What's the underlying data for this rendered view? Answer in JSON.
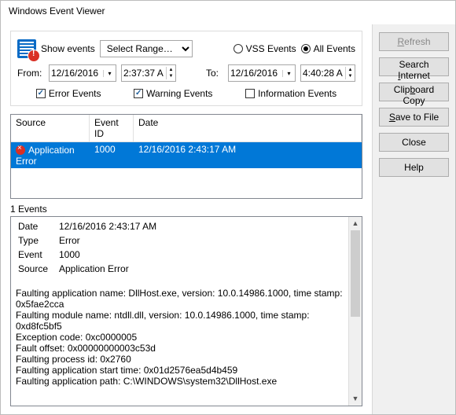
{
  "title": "Windows Event Viewer",
  "buttons": {
    "refresh": "Refresh",
    "search": "Search Internet",
    "clipboard": "Clipboard Copy",
    "save": "Save to File",
    "close": "Close",
    "help": "Help"
  },
  "filter": {
    "show_events_label": "Show events",
    "range_select": "Select Range…",
    "vss_label": "VSS Events",
    "all_label": "All Events",
    "from_label": "From:",
    "to_label": "To:",
    "from_date": "12/16/2016",
    "from_time": "2:37:37 A",
    "to_date": "12/16/2016",
    "to_time": "4:40:28 A",
    "error_label": "Error Events",
    "warning_label": "Warning Events",
    "info_label": "Information Events"
  },
  "columns": {
    "source": "Source",
    "event_id": "Event ID",
    "date": "Date"
  },
  "rows": [
    {
      "source": "Application Error",
      "event_id": "1000",
      "date": "12/16/2016 2:43:17 AM"
    }
  ],
  "count_label": "1 Events",
  "details": {
    "labels": {
      "date": "Date",
      "type": "Type",
      "event": "Event",
      "source": "Source"
    },
    "date": "12/16/2016 2:43:17 AM",
    "type": "Error",
    "event": "1000",
    "source": "Application Error",
    "body": "Faulting application name: DllHost.exe, version: 10.0.14986.1000, time stamp: 0x5fae2cca\nFaulting module name: ntdll.dll, version: 10.0.14986.1000, time stamp: 0xd8fc5bf5\nException code: 0xc0000005\nFault offset: 0x00000000003c53d\nFaulting process id: 0x2760\nFaulting application start time: 0x01d2576ea5d4b459\nFaulting application path: C:\\WINDOWS\\system32\\DllHost.exe"
  }
}
